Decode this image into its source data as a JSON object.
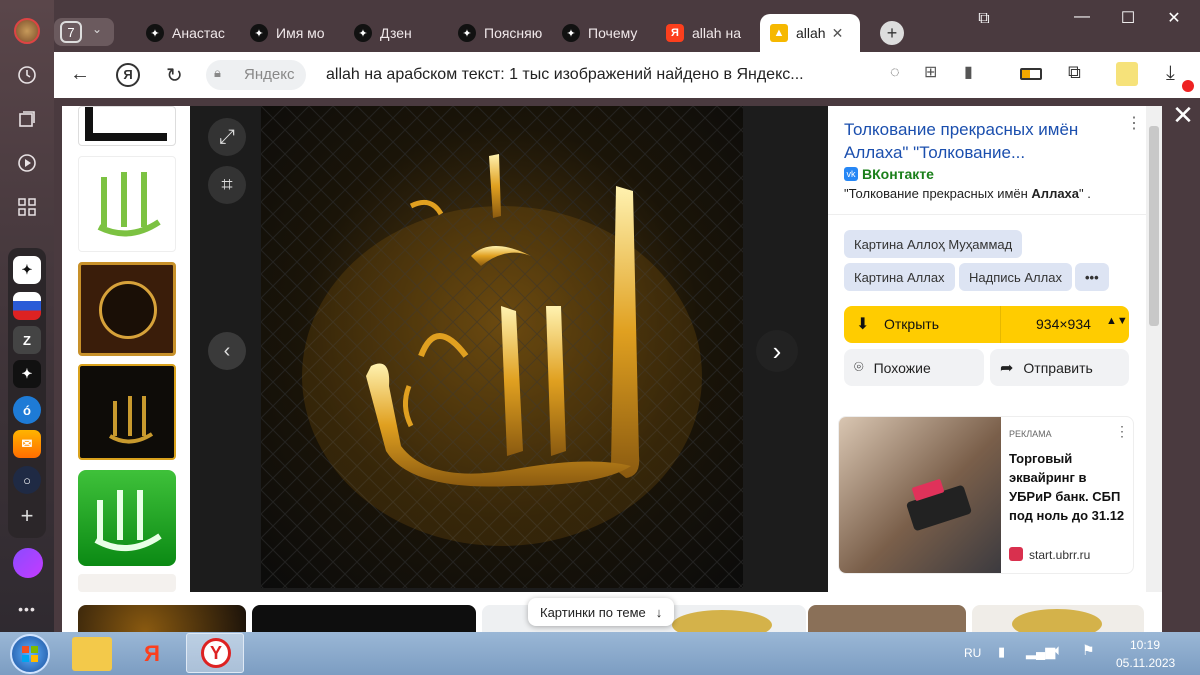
{
  "browser": {
    "tab_count": "7",
    "tabs": [
      {
        "label": "Анастас"
      },
      {
        "label": "Имя мо"
      },
      {
        "label": "Дзен"
      },
      {
        "label": "Поясняю"
      },
      {
        "label": "Почему"
      },
      {
        "label": "allah на"
      },
      {
        "label": "allah"
      }
    ],
    "address": {
      "site": "Яндекс",
      "page_title": "allah на арабском текст: 1 тыс изображений найдено в Яндекс..."
    },
    "close_x": "✕"
  },
  "viewer": {
    "panel": {
      "title": "Толкование прекрасных имён Аллаха\" \"Толкование...",
      "source": "ВКонтакте",
      "desc_prefix": "\"Толкование прекрасных имён ",
      "desc_bold": "Аллаха",
      "desc_suffix": "\" .",
      "chips": [
        "Картина Аллоҳ Муҳаммад",
        "Картина Аллах",
        "Надпись Аллах",
        "•••"
      ],
      "open_label": "Открыть",
      "size_label": "934×934",
      "similar_label": "Похожие",
      "share_label": "Отправить",
      "ad": {
        "tag": "РЕКЛАМА",
        "text": "Торговый эквайринг в УБРиР банк. СБП под ноль до 31.12",
        "domain": "start.ubrr.ru"
      }
    },
    "related_label": "Картинки по теме"
  },
  "taskbar": {
    "lang": "RU",
    "time": "10:19",
    "date": "05.11.2023"
  },
  "colors": {
    "accent_yellow": "#ffcc00",
    "link_blue": "#1b4fae",
    "chip_bg": "#dde4f3"
  }
}
